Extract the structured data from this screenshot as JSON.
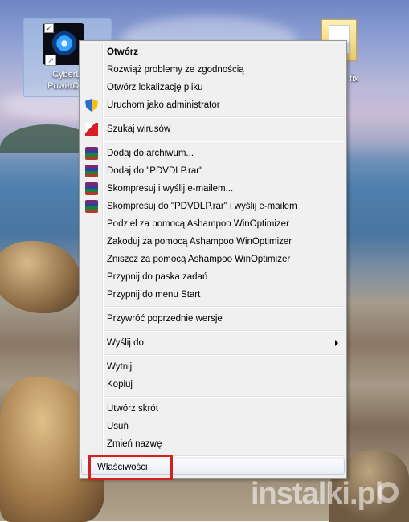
{
  "desktop": {
    "shortcut_label_line1": "CyberLi",
    "shortcut_label_line2": "PowerDVI",
    "folder_label": "e fix",
    "watermark": "instalki.pl"
  },
  "context_menu": {
    "items": [
      {
        "label": "Otwórz",
        "bold": true,
        "icon": ""
      },
      {
        "label": "Rozwiąż problemy ze zgodnością",
        "icon": ""
      },
      {
        "label": "Otwórz lokalizację pliku",
        "icon": ""
      },
      {
        "label": "Uruchom jako administrator",
        "icon": "uac-shield-icon"
      },
      {
        "label": "Szukaj wirusów",
        "icon": "antivirus-icon"
      },
      {
        "label": "Dodaj do archiwum...",
        "icon": "winrar-icon"
      },
      {
        "label": "Dodaj do \"PDVDLP.rar\"",
        "icon": "winrar-icon"
      },
      {
        "label": "Skompresuj i wyślij e-mailem...",
        "icon": "winrar-icon"
      },
      {
        "label": "Skompresuj do \"PDVDLP.rar\" i wyślij e-mailem",
        "icon": "winrar-icon"
      },
      {
        "label": "Podziel za pomocą Ashampoo WinOptimizer",
        "icon": ""
      },
      {
        "label": "Zakoduj za pomocą Ashampoo WinOptimizer",
        "icon": ""
      },
      {
        "label": "Zniszcz za pomocą Ashampoo WinOptimizer",
        "icon": ""
      },
      {
        "label": "Przypnij do paska zadań",
        "icon": ""
      },
      {
        "label": "Przypnij do menu Start",
        "icon": ""
      },
      {
        "label": "Przywróć poprzednie wersje",
        "icon": ""
      },
      {
        "label": "Wyślij do",
        "icon": "",
        "submenu": true
      },
      {
        "label": "Wytnij",
        "icon": ""
      },
      {
        "label": "Kopiuj",
        "icon": ""
      },
      {
        "label": "Utwórz skrót",
        "icon": ""
      },
      {
        "label": "Usuń",
        "icon": ""
      },
      {
        "label": "Zmień nazwę",
        "icon": ""
      },
      {
        "label": "Właściwości",
        "icon": "",
        "highlighted": true
      }
    ]
  },
  "colors": {
    "menu_bg": "#f0f0f0",
    "highlight_border": "#d32020"
  }
}
